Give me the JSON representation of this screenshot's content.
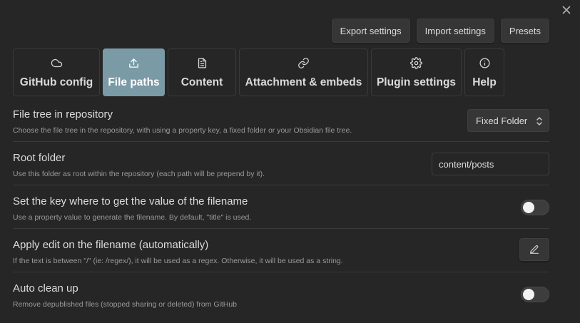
{
  "window": {
    "close_icon": "close-icon"
  },
  "toolbar": {
    "export_label": "Export settings",
    "import_label": "Import settings",
    "presets_label": "Presets"
  },
  "tabs": [
    {
      "label": "GitHub config",
      "icon": "cloud-icon",
      "active": false
    },
    {
      "label": "File paths",
      "icon": "upload-icon",
      "active": true
    },
    {
      "label": "Content",
      "icon": "file-text-icon",
      "active": false
    },
    {
      "label": "Attachment & embeds",
      "icon": "link-icon",
      "active": false
    },
    {
      "label": "Plugin settings",
      "icon": "gear-icon",
      "active": false
    },
    {
      "label": "Help",
      "icon": "info-icon",
      "active": false
    }
  ],
  "settings": {
    "file_tree": {
      "name": "File tree in repository",
      "desc": "Choose the file tree in the repository, with using a property key, a fixed folder or your Obsidian file tree.",
      "value": "Fixed Folder"
    },
    "root_folder": {
      "name": "Root folder",
      "desc": "Use this folder as root within the repository (each path will be prepend by it).",
      "value": "content/posts"
    },
    "filename_key": {
      "name": "Set the key where to get the value of the filename",
      "desc": "Use a property value to generate the filename. By default, \"title\" is used.",
      "enabled": false
    },
    "filename_edit": {
      "name": "Apply edit on the filename (automatically)",
      "desc": "If the text is between \"/\" (ie: /regex/), it will be used as a regex. Otherwise, it will be used as a string.",
      "icon": "pencil-icon"
    },
    "auto_clean": {
      "name": "Auto clean up",
      "desc": "Remove depublished files (stopped sharing or deleted) from GitHub",
      "enabled": false
    }
  }
}
